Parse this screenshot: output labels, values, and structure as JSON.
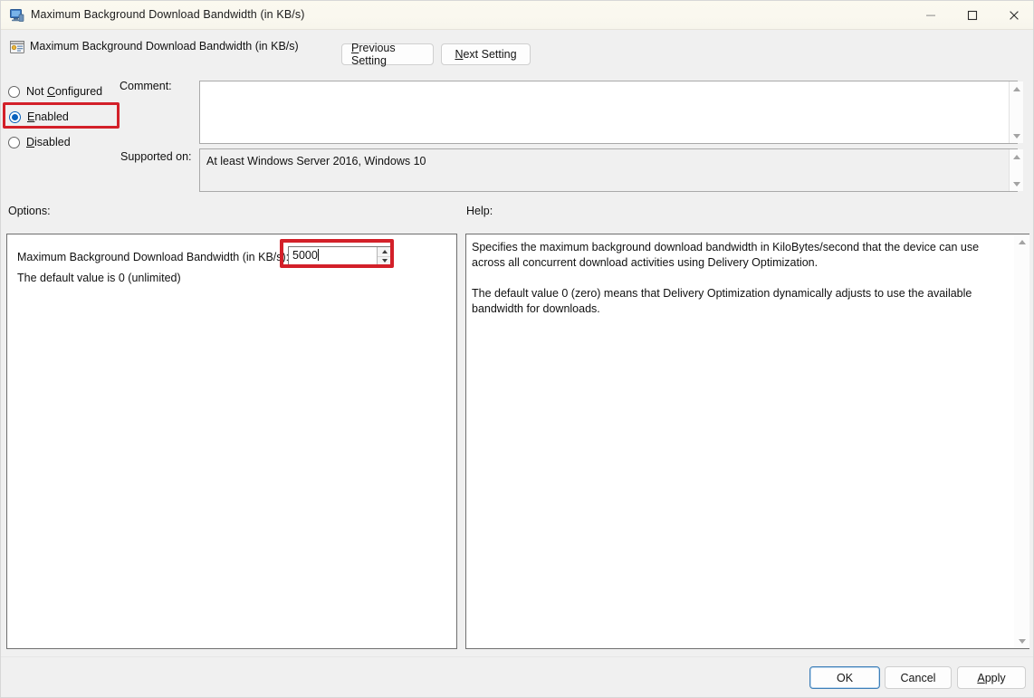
{
  "window": {
    "title": "Maximum Background Download Bandwidth (in KB/s)",
    "icon": "computer-monitor-icon",
    "controls": {
      "minimize": "Minimize",
      "maximize": "Maximize",
      "close": "Close"
    }
  },
  "header": {
    "icon": "policy-setting-icon",
    "title": "Maximum Background Download Bandwidth (in KB/s)",
    "previous_setting": "Previous Setting",
    "previous_accel": "P",
    "next_setting": "Next Setting",
    "next_accel": "N"
  },
  "state": {
    "options": [
      {
        "label": "Not Configured",
        "accel": "C",
        "selected": false
      },
      {
        "label": "Enabled",
        "accel": "E",
        "selected": true
      },
      {
        "label": "Disabled",
        "accel": "D",
        "selected": false
      }
    ],
    "highlighted_option": "Enabled",
    "highlight_color": "#d32029"
  },
  "comment": {
    "label": "Comment:",
    "value": "",
    "placeholder": ""
  },
  "supported": {
    "label": "Supported on:",
    "value": "At least Windows Server 2016, Windows 10"
  },
  "options_section": {
    "label": "Options:",
    "setting_label": "Maximum Background Download Bandwidth (in KB/s):",
    "setting_value": "5000",
    "default_note": "The default value is 0 (unlimited)",
    "spinner_up_icon": "chevron-up-icon",
    "spinner_down_icon": "chevron-down-icon"
  },
  "help_section": {
    "label": "Help:",
    "paragraph_1": "Specifies the maximum background download bandwidth in KiloBytes/second that the device can use across all concurrent download activities using Delivery Optimization.",
    "paragraph_2": "The default value 0 (zero) means that Delivery Optimization dynamically adjusts to use the available bandwidth for downloads."
  },
  "footer": {
    "ok": "OK",
    "cancel": "Cancel",
    "apply": "Apply",
    "apply_accel": "A"
  }
}
